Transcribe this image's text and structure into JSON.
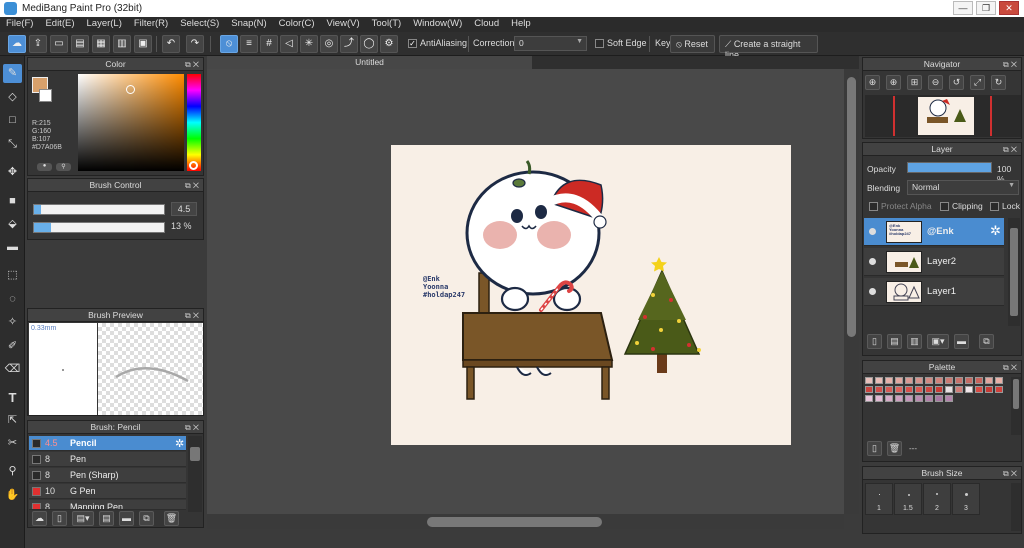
{
  "app": {
    "title": "MediBang Paint Pro (32bit)"
  },
  "window_controls": {
    "minimize": "—",
    "maximize": "❐",
    "close": "✕"
  },
  "menu": [
    "File(F)",
    "Edit(E)",
    "Layer(L)",
    "Filter(R)",
    "Select(S)",
    "Snap(N)",
    "Color(C)",
    "View(V)",
    "Tool(T)",
    "Window(W)",
    "Cloud",
    "Help"
  ],
  "toolbar": {
    "antialiasing_label": "AntiAliasing",
    "antialiasing_checked": true,
    "correction_label": "Correction",
    "correction_value": "0",
    "soft_edge_label": "Soft Edge",
    "soft_edge_checked": false,
    "key_label": "Key",
    "reset_label": "Reset",
    "straight_line_label": "Create a straight line"
  },
  "color_panel": {
    "title": "Color",
    "r": "R:215",
    "g": "G:160",
    "b": "B:107",
    "hex": "#D7A06B",
    "main_color": "#D7A06B",
    "sub_color": "#ffffff"
  },
  "brush_control": {
    "title": "Brush Control",
    "size_value": "4.5",
    "size_fraction": 0.05,
    "opacity_value": "13 %",
    "opacity_fraction": 0.13
  },
  "brush_preview": {
    "title": "Brush Preview",
    "size_text": "0.33mm"
  },
  "brush_list": {
    "title": "Brush: Pencil",
    "items": [
      {
        "size": "4.5",
        "name": "Pencil",
        "color": "#2a2a2a",
        "selected": true
      },
      {
        "size": "8",
        "name": "Pen",
        "color": "#2a2a2a",
        "selected": false
      },
      {
        "size": "8",
        "name": "Pen (Sharp)",
        "color": "#2a2a2a",
        "selected": false
      },
      {
        "size": "10",
        "name": "G Pen",
        "color": "#e03030",
        "selected": false
      },
      {
        "size": "8",
        "name": "Mapping Pen",
        "color": "#e03030",
        "selected": false
      }
    ]
  },
  "document": {
    "tab_title": "Untitled"
  },
  "artwork": {
    "watermark_1": "@Enk",
    "watermark_2": "Yoonna",
    "watermark_3": "#holdap247"
  },
  "navigator": {
    "title": "Navigator"
  },
  "layer_panel": {
    "title": "Layer",
    "opacity_label": "Opacity",
    "opacity_value": "100 %",
    "opacity_fraction": 1.0,
    "blending_label": "Blending",
    "blending_value": "Normal",
    "protect_alpha_label": "Protect Alpha",
    "clipping_label": "Clipping",
    "lock_label": "Lock",
    "layers": [
      {
        "name": "@Enk",
        "selected": true
      },
      {
        "name": "Layer2",
        "selected": false
      },
      {
        "name": "Layer1",
        "selected": false
      }
    ]
  },
  "palette": {
    "title": "Palette",
    "footer_text": "---",
    "colors": [
      "#e7c0bb",
      "#e9bcb6",
      "#e6b1aa",
      "#e2a7a0",
      "#d99993",
      "#d6928c",
      "#d28a83",
      "#d0827b",
      "#cb7a73",
      "#c7726b",
      "#c56c65",
      "#c8645d",
      "#e2a59e",
      "#e9b0a7",
      "#c9443f",
      "#d24e49",
      "#d65a54",
      "#de625c",
      "#d8504a",
      "#dc5851",
      "#cf4741",
      "#c93c36",
      "#e8e0e2",
      "#d07d78",
      "#f2e6ea",
      "#d84c45",
      "#c73b35",
      "#d0423c",
      "#e7c4da",
      "#e2bad3",
      "#d8acc8",
      "#cfa1c1",
      "#c697ba",
      "#bc8cb1",
      "#b382aa",
      "#a978a3",
      "#b485ad"
    ]
  },
  "brush_size": {
    "title": "Brush Size",
    "sizes": [
      "1",
      "1.5",
      "2",
      "3"
    ]
  }
}
